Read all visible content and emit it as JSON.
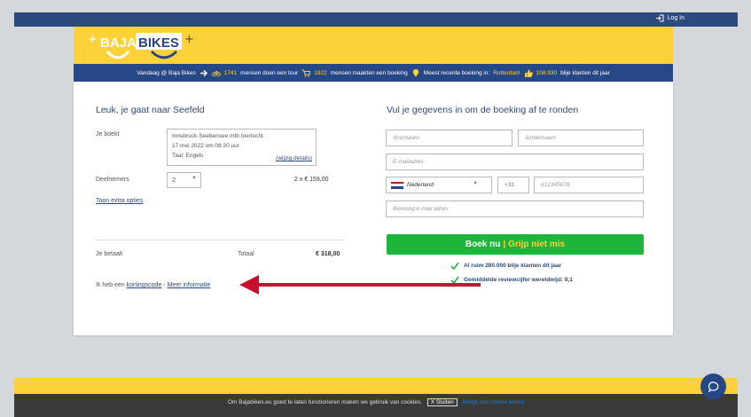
{
  "topbar": {
    "login_label": "Log In"
  },
  "header": {
    "logo_left": "BAJA",
    "logo_right": "BIKES"
  },
  "infobar": {
    "intro": "Vandaag @ Baja Bikes",
    "tour_count": "1741",
    "tour_text": "mensen doen een tour",
    "booking_count": "1922",
    "booking_text": "mensen maakten een boeking",
    "recent_text": "Meest recente boeking in:",
    "recent_city": "Rotterdam",
    "happy_count": "108.930",
    "happy_text": "blije klanten dit jaar"
  },
  "left": {
    "title": "Leuk, je gaat naar Seefeld",
    "je_boekt_label": "Je boekt",
    "tour_name": "Innsbruck-Seebensee mtb toertocht",
    "tour_date": "17 mei 2022 om 08:20 uur",
    "tour_lang": "Taal: Engels",
    "wijzig_link": "(wijzig details)",
    "deelnemers_label": "Deelnemers",
    "deelnemers_value": "2",
    "price_line": "2 x € 159,00",
    "extra_link": "Toon extra opties",
    "je_betaalt_label": "Je betaalt",
    "totaal_label": "Totaal",
    "total_value": "€ 318,00",
    "korting_prefix": "Ik heb een",
    "korting_link": "kortingscode",
    "separator": " - ",
    "info_link": "Meer informatie"
  },
  "right": {
    "title": "Vul je gegevens in om de boeking af te ronden",
    "voornaam_ph": "Voornaam",
    "achternaam_ph": "Achternaam",
    "email_ph": "E-mailadres",
    "country_value": "Nederland",
    "prefix_value": "+31",
    "phone_ph": "612345678",
    "confirm_email_ph": "Bevestig e-mail adres",
    "book_label": "Boek nu",
    "book_sep": "|",
    "book_sub": "Grijp niet mis",
    "check1": "Al ruim 280.000 blije klanten dit jaar",
    "check2": "Gemiddelde reviewcijfer wereldwijd: 9,1"
  },
  "cookie": {
    "text": "Om Bajabikes.eu goed te laten functioneren maken we gebruik van cookies.",
    "close_label": "X Sluiten",
    "policy_link": "Bekijk ons cookie beleid"
  },
  "colors": {
    "brand_blue": "#274886",
    "brand_yellow": "#fdd238",
    "cta_green": "#1db53c",
    "arrow_red": "#c8102e"
  }
}
